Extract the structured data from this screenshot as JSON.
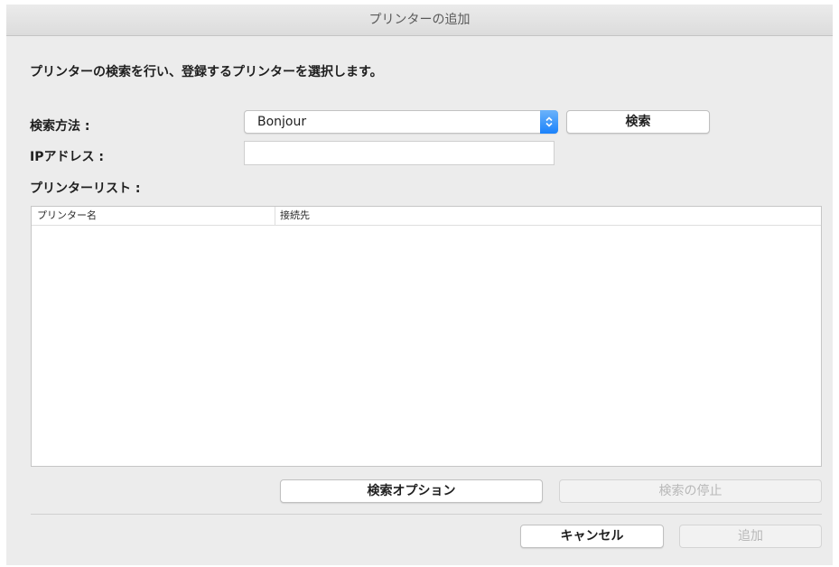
{
  "window": {
    "title": "プリンターの追加"
  },
  "instruction": "プリンターの検索を行い、登録するプリンターを選択します。",
  "search_method": {
    "label": "検索方法 :",
    "value": "Bonjour"
  },
  "search_button": "検索",
  "ip_address": {
    "label": "IPアドレス :",
    "value": ""
  },
  "printer_list": {
    "label": "プリンターリスト :",
    "columns": [
      "プリンター名",
      "接続先"
    ],
    "rows": []
  },
  "buttons": {
    "search_options": "検索オプション",
    "stop_search": "検索の停止",
    "cancel": "キャンセル",
    "add": "追加"
  },
  "colors": {
    "accent": "#1a82fb",
    "window_bg": "#ececec"
  }
}
